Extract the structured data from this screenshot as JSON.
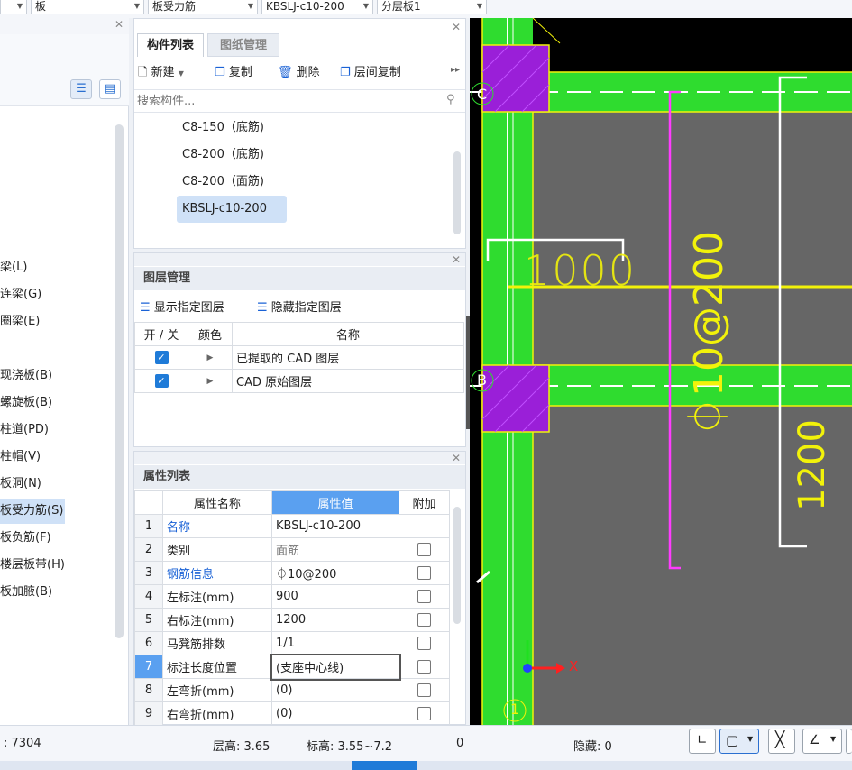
{
  "toolbar": {
    "combo1": "",
    "combo2": "板",
    "combo3": "板受力筋",
    "combo4": "KBSLJ-c10-200",
    "combo5": "分层板1"
  },
  "left_tree": {
    "items": [
      {
        "label": "梁(L)"
      },
      {
        "label": "连梁(G)"
      },
      {
        "label": "圈梁(E)"
      },
      {
        "label": "现浇板(B)"
      },
      {
        "label": "螺旋板(B)"
      },
      {
        "label": "柱道(PD)"
      },
      {
        "label": "柱帽(V)"
      },
      {
        "label": "板洞(N)"
      },
      {
        "label": "板受力筋(S)"
      },
      {
        "label": "板负筋(F)"
      },
      {
        "label": "楼层板带(H)"
      },
      {
        "label": "板加腋(B)"
      }
    ],
    "selected_index": 8
  },
  "component_panel": {
    "tab_active": "构件列表",
    "tab_inactive": "图纸管理",
    "btn_new": "新建",
    "btn_copy": "复制",
    "btn_delete": "删除",
    "btn_floor_copy": "层间复制",
    "search_placeholder": "搜索构件...",
    "items": [
      "C8-150（底筋)",
      "C8-200（底筋)",
      "C8-200（面筋)",
      "KBSLJ-c10-200"
    ],
    "selected_index": 3
  },
  "layer_panel": {
    "title": "图层管理",
    "btn_show": "显示指定图层",
    "btn_hide": "隐藏指定图层",
    "col_onoff": "开 / 关",
    "col_color": "颜色",
    "col_name": "名称",
    "rows": [
      {
        "on": true,
        "name": "已提取的 CAD 图层"
      },
      {
        "on": true,
        "name": "CAD 原始图层"
      }
    ]
  },
  "props_panel": {
    "title": "属性列表",
    "col_name": "属性名称",
    "col_value": "属性值",
    "col_extra": "附加",
    "rows": [
      {
        "idx": "1",
        "name": "名称",
        "value": "KBSLJ-c10-200",
        "blue": true,
        "gray_value": false,
        "check": false
      },
      {
        "idx": "2",
        "name": "类别",
        "value": "面筋",
        "blue": false,
        "gray_value": true,
        "check": true
      },
      {
        "idx": "3",
        "name": "钢筋信息",
        "value": "⏀10@200",
        "blue": true,
        "gray_value": false,
        "check": true
      },
      {
        "idx": "4",
        "name": "左标注(mm)",
        "value": "900",
        "blue": false,
        "gray_value": false,
        "check": true
      },
      {
        "idx": "5",
        "name": "右标注(mm)",
        "value": "1200",
        "blue": false,
        "gray_value": false,
        "check": true
      },
      {
        "idx": "6",
        "name": "马凳筋排数",
        "value": "1/1",
        "blue": false,
        "gray_value": false,
        "check": true
      },
      {
        "idx": "7",
        "name": "标注长度位置",
        "value": "(支座中心线)",
        "blue": false,
        "gray_value": false,
        "check": true
      },
      {
        "idx": "8",
        "name": "左弯折(mm)",
        "value": "(0)",
        "blue": false,
        "gray_value": false,
        "check": true
      },
      {
        "idx": "9",
        "name": "右弯折(mm)",
        "value": "(0)",
        "blue": false,
        "gray_value": false,
        "check": true
      }
    ],
    "selected_index": 6
  },
  "cad": {
    "label_c": "C",
    "label_b": "B",
    "label_1": "1",
    "dim_1000": "1000",
    "dim_rebar": "⏀10@200",
    "dim_1200": "1200",
    "axis_x": "X"
  },
  "status": {
    "coords": ": 7304",
    "floor_height": "层高: 3.65",
    "elevation": "标高: 3.55~7.2",
    "zero": "0",
    "hidden": "隐藏: 0"
  },
  "colors": {
    "cad_green": "#2fdc2f",
    "cad_purple": "#9a1fd8",
    "cad_gray": "#666666",
    "cad_magenta": "#ff3cff",
    "cad_yellow": "#f2f20a",
    "accent_blue": "#5aa0f0"
  }
}
